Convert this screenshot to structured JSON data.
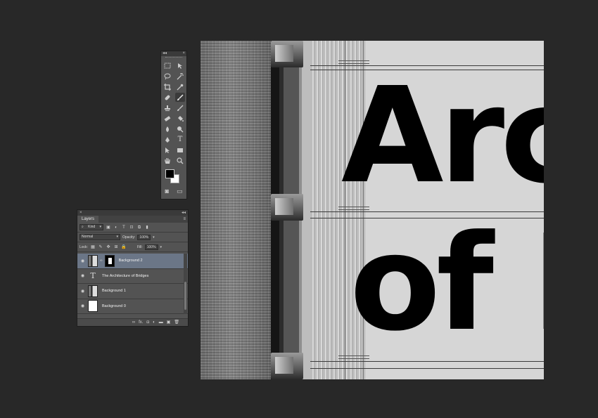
{
  "canvas": {
    "title_line1": "Arc",
    "title_line2": "of I"
  },
  "tools_panel": {
    "collapse_glyph": "◂◂",
    "close_glyph": "×",
    "tools": [
      [
        "marquee-icon",
        "move-icon"
      ],
      [
        "lasso-icon",
        "magic-wand-icon"
      ],
      [
        "crop-icon",
        "eyedropper-icon"
      ],
      [
        "healing-brush-icon",
        "brush-icon"
      ],
      [
        "clone-stamp-icon",
        "history-brush-icon"
      ],
      [
        "eraser-icon",
        "paint-bucket-icon"
      ],
      [
        "blur-icon",
        "dodge-icon"
      ],
      [
        "pen-icon",
        "type-icon"
      ],
      [
        "path-selection-icon",
        "rectangle-icon"
      ],
      [
        "hand-icon",
        "zoom-icon"
      ]
    ],
    "type_tool_glyph": "T",
    "foreground_color": "#000000",
    "background_color": "#ffffff"
  },
  "layers_panel": {
    "collapse_glyph": "◂◂",
    "close_glyph": "×",
    "tab_label": "Layers",
    "menu_glyph": "≡",
    "filter_kind": "Kind",
    "blend_mode": "Normal",
    "opacity_label": "Opacity:",
    "opacity_value": "100%",
    "lock_label": "Lock:",
    "fill_label": "Fill:",
    "fill_value": "100%",
    "layers": [
      {
        "name": "Background 2",
        "kind": "masked-pixel",
        "selected": true,
        "visible": true
      },
      {
        "name": "The Architecture of Bridges",
        "kind": "type",
        "selected": false,
        "visible": true
      },
      {
        "name": "Background 1",
        "kind": "pixel",
        "selected": false,
        "visible": true
      },
      {
        "name": "Background 0",
        "kind": "pixel-white",
        "selected": false,
        "visible": true
      }
    ],
    "footer_glyphs": {
      "link": "∞",
      "fx": "fx.",
      "mask": "◘",
      "adjustment": "◐",
      "group": "▬",
      "new_layer": "▣",
      "delete": "🗑"
    }
  },
  "colors": {
    "app_background": "#282828",
    "panel_background": "#535353",
    "selected_layer": "#6b7687"
  }
}
